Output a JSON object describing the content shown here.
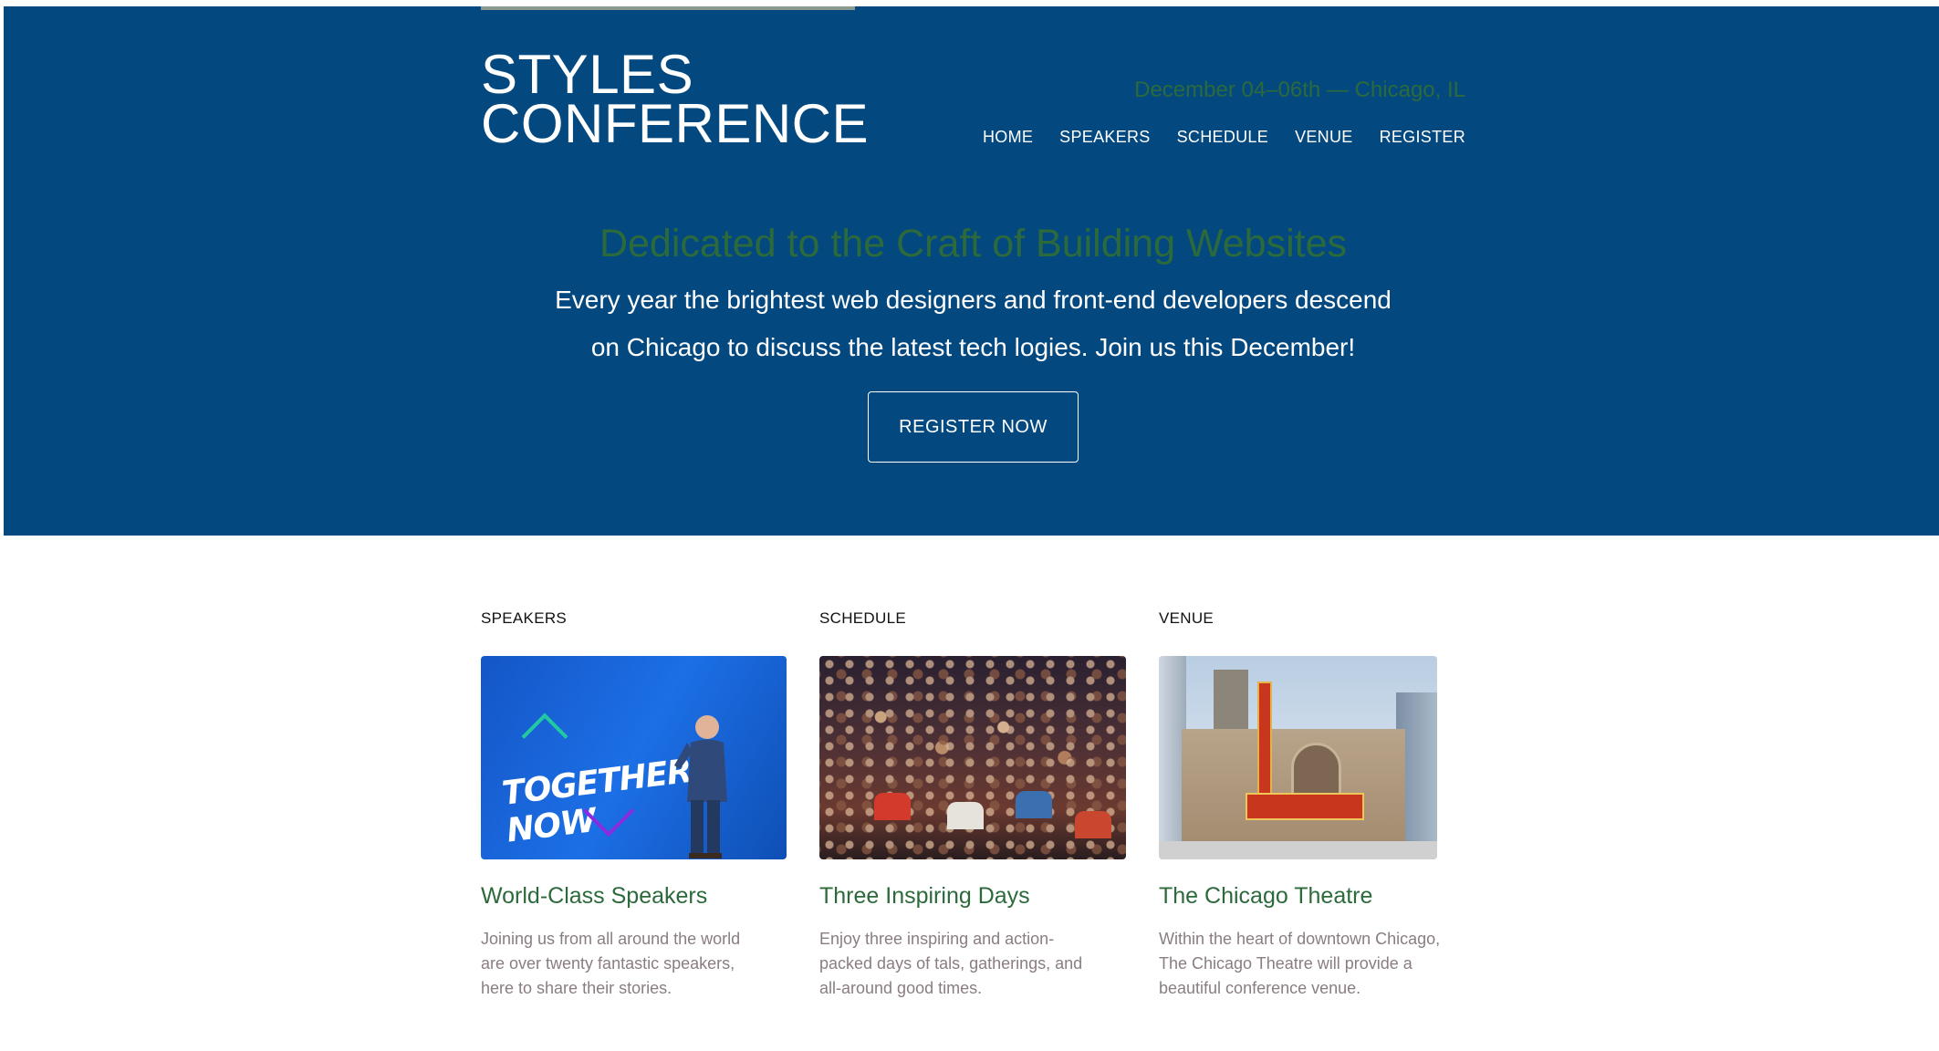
{
  "header": {
    "logo_line1": "STYLES",
    "logo_line2": "CONFERENCE",
    "dates": "December 04–06th — Chicago, IL",
    "nav": [
      "HOME",
      "SPEAKERS",
      "SCHEDULE",
      "VENUE",
      "REGISTER"
    ]
  },
  "hero": {
    "tagline": "Dedicated to the Craft of Building Websites",
    "intro_line1": "Every year the brightest web designers and front-end developers descend",
    "intro_line2": "on Chicago to discuss the latest tech logies. Join us this December!",
    "cta": "REGISTER NOW"
  },
  "features": [
    {
      "label": "SPEAKERS",
      "heading": "World-Class Speakers",
      "desc_lines": [
        "Joining us from all around the world",
        "are over twenty fantastic speakers,",
        "here to share their stories."
      ],
      "image_text": "TOGETHER NOW"
    },
    {
      "label": "SCHEDULE",
      "heading": "Three Inspiring Days",
      "desc_lines": [
        "Enjoy three inspiring and action-",
        "packed days of tals, gatherings, and",
        "all-around good times."
      ]
    },
    {
      "label": "VENUE",
      "heading": "The Chicago Theatre",
      "desc_lines": [
        "Within the heart of downtown Chicago,",
        "The Chicago Theatre will provide a",
        "beautiful conference venue."
      ]
    }
  ],
  "colors": {
    "hero_bg": "#03497f",
    "accent_green": "#2c6a3c",
    "desc_text": "#8a7d7f"
  }
}
